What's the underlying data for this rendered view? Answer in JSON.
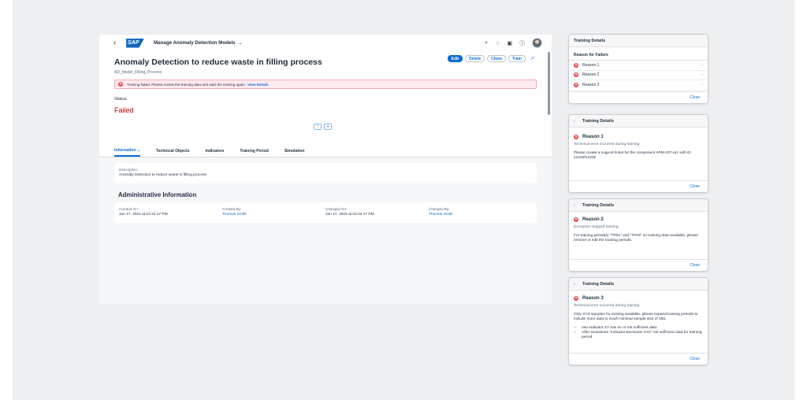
{
  "shell": {
    "back": "‹",
    "logo": "SAP",
    "app_title": "Manage Anomaly Detection Models",
    "app_title_chev": "⌄"
  },
  "header": {
    "title": "Anomaly Detection to reduce waste in filling process",
    "subtitle": "AD_Model_Filling_Process",
    "actions": {
      "edit": "Edit",
      "delete": "Delete",
      "clone": "Clone",
      "train": "Train"
    },
    "error_message": "Training failed. Please review the training data and start the training again.",
    "error_link": "View Details",
    "status_label": "Status",
    "status_value": "Failed"
  },
  "tabs": [
    {
      "label": "Information ⌄"
    },
    {
      "label": "Technical Objects"
    },
    {
      "label": "Indicators"
    },
    {
      "label": "Training Period"
    },
    {
      "label": "Simulation"
    }
  ],
  "description": {
    "label": "Description:",
    "value": "Anomaly Detection to reduce waste in filling process"
  },
  "admin": {
    "title": "Administrative Information",
    "created_on_label": "Created On:",
    "created_on": "Jan 17, 2024 at 03:22:17 PM",
    "created_by_label": "Created By:",
    "created_by": "Thomas Smith",
    "changed_on_label": "Changed On:",
    "changed_on": "Jan 17, 2024 at 03:22:17 PM",
    "changed_by_label": "Changed By:",
    "changed_by": "Thomas Smith"
  },
  "panel_list": {
    "title": "Training Details",
    "subtitle": "Reason for Failure",
    "reasons": [
      "Reason 1",
      "Reason 2",
      "Reason 3"
    ],
    "close": "Close"
  },
  "panel_reason1": {
    "head": "Training Details",
    "title": "Reason 1",
    "sub": "Technical error occurred during training",
    "body": "Please create a support ticket for the component APM-IOT-xyz with ID e1234f12345",
    "close": "Close"
  },
  "panel_reason2": {
    "head": "Training Details",
    "title": "Reason 2",
    "sub": "Exception stopped training",
    "body": "For training period(s) \"TP01\" and \"TP03\" no training data available, please remove or edit the training periods.",
    "close": "Close"
  },
  "panel_reason3": {
    "head": "Training Details",
    "title": "Reason 3",
    "sub": "Technical error occurred during training",
    "body": "Only XYZ samples for training available. please expand training periods to include more data to reach minimal sample size of 256.",
    "bullets": [
      "one indicator XY has no or not sufficient data",
      "After exclusions \"Indicator Exclusion XYZ\" not sufficient data for training period"
    ],
    "close": "Close"
  }
}
